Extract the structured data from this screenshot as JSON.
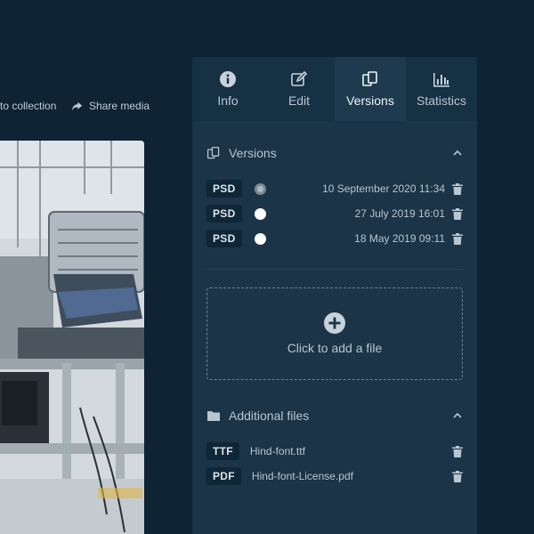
{
  "toolbar": {
    "add_to_collection": "to collection",
    "share_media": "Share media"
  },
  "tabs": [
    {
      "label": "Info",
      "icon": "info-icon",
      "active": false
    },
    {
      "label": "Edit",
      "icon": "edit-icon",
      "active": false
    },
    {
      "label": "Versions",
      "icon": "versions-icon",
      "active": true
    },
    {
      "label": "Statistics",
      "icon": "statistics-icon",
      "active": false
    }
  ],
  "versions": {
    "title": "Versions",
    "items": [
      {
        "format": "PSD",
        "date": "10 September 2020 11:34",
        "selected": true
      },
      {
        "format": "PSD",
        "date": "27 July 2019 16:01",
        "selected": false
      },
      {
        "format": "PSD",
        "date": "18 May 2019 09:11",
        "selected": false
      }
    ]
  },
  "dropzone": {
    "label": "Click to add a file"
  },
  "additional_files": {
    "title": "Additional files",
    "items": [
      {
        "format": "TTF",
        "name": "Hind-font.ttf"
      },
      {
        "format": "PDF",
        "name": "Hind-font-License.pdf"
      }
    ]
  },
  "colors": {
    "background": "#0e2334",
    "panel": "#1b3447",
    "active_tab": "#1f3a4f"
  }
}
